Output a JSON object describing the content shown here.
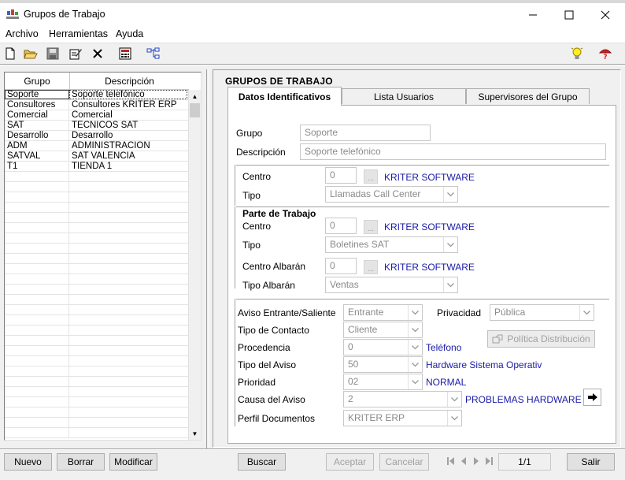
{
  "window": {
    "title": "Grupos de Trabajo",
    "minimize": "—",
    "maximize": "☐",
    "close": "✕"
  },
  "menu": [
    "Archivo",
    "Herramientas",
    "Ayuda"
  ],
  "list": {
    "headers": [
      "Grupo",
      "Descripción"
    ],
    "rows": [
      [
        "Soporte",
        "Soporte telefónico"
      ],
      [
        "Consultores",
        "Consultores KRITER ERP"
      ],
      [
        "Comercial",
        "Comercial"
      ],
      [
        "SAT",
        "TECNICOS SAT"
      ],
      [
        "Desarrollo",
        "Desarrollo"
      ],
      [
        "ADM",
        "ADMINISTRACION"
      ],
      [
        "SATVAL",
        "SAT VALENCIA"
      ],
      [
        "T1",
        "TIENDA 1"
      ]
    ],
    "selected_index": 0
  },
  "panel": {
    "title": "GRUPOS DE TRABAJO",
    "tabs": [
      "Datos Identificativos",
      "Lista Usuarios",
      "Supervisores del Grupo"
    ],
    "active_tab": 0
  },
  "form": {
    "grupo": {
      "label": "Grupo",
      "value": "Soporte"
    },
    "descripcion": {
      "label": "Descripción",
      "value": "Soporte telefónico"
    },
    "centro": {
      "label": "Centro",
      "value": "0",
      "name": "KRITER SOFTWARE"
    },
    "tipo": {
      "label": "Tipo",
      "value": "Llamadas Call Center"
    },
    "parte_trabajo": {
      "heading": "Parte de Trabajo",
      "centro": {
        "label": "Centro",
        "value": "0",
        "name": "KRITER SOFTWARE"
      },
      "tipo": {
        "label": "Tipo",
        "value": "Boletines SAT"
      },
      "centro_albaran": {
        "label": "Centro Albarán",
        "value": "0",
        "name": "KRITER SOFTWARE"
      },
      "tipo_albaran": {
        "label": "Tipo Albarán",
        "value": "Ventas"
      }
    },
    "aviso": {
      "label": "Aviso Entrante/Saliente",
      "value": "Entrante"
    },
    "privacidad": {
      "label": "Privacidad",
      "value": "Pública"
    },
    "tipo_contacto": {
      "label": "Tipo de Contacto",
      "value": "Cliente"
    },
    "politica_button": "Política Distribución",
    "procedencia": {
      "label": "Procedencia",
      "value": "0",
      "name": "Teléfono"
    },
    "tipo_aviso": {
      "label": "Tipo del Aviso",
      "value": "50",
      "name": "Hardware Sistema Operativ"
    },
    "prioridad": {
      "label": "Prioridad",
      "value": "02",
      "name": "NORMAL"
    },
    "causa": {
      "label": "Causa del Aviso",
      "value": "2",
      "name": "PROBLEMAS HARDWARE"
    },
    "perfil": {
      "label": "Perfil Documentos",
      "value": "KRITER ERP"
    }
  },
  "buttons": {
    "nuevo": "Nuevo",
    "borrar": "Borrar",
    "modificar": "Modificar",
    "buscar": "Buscar",
    "aceptar": "Aceptar",
    "cancelar": "Cancelar",
    "salir": "Salir"
  },
  "pager": "1/1",
  "colors": {
    "link_blue": "#1a1aa8",
    "disabled_text": "#8a8a8a"
  }
}
